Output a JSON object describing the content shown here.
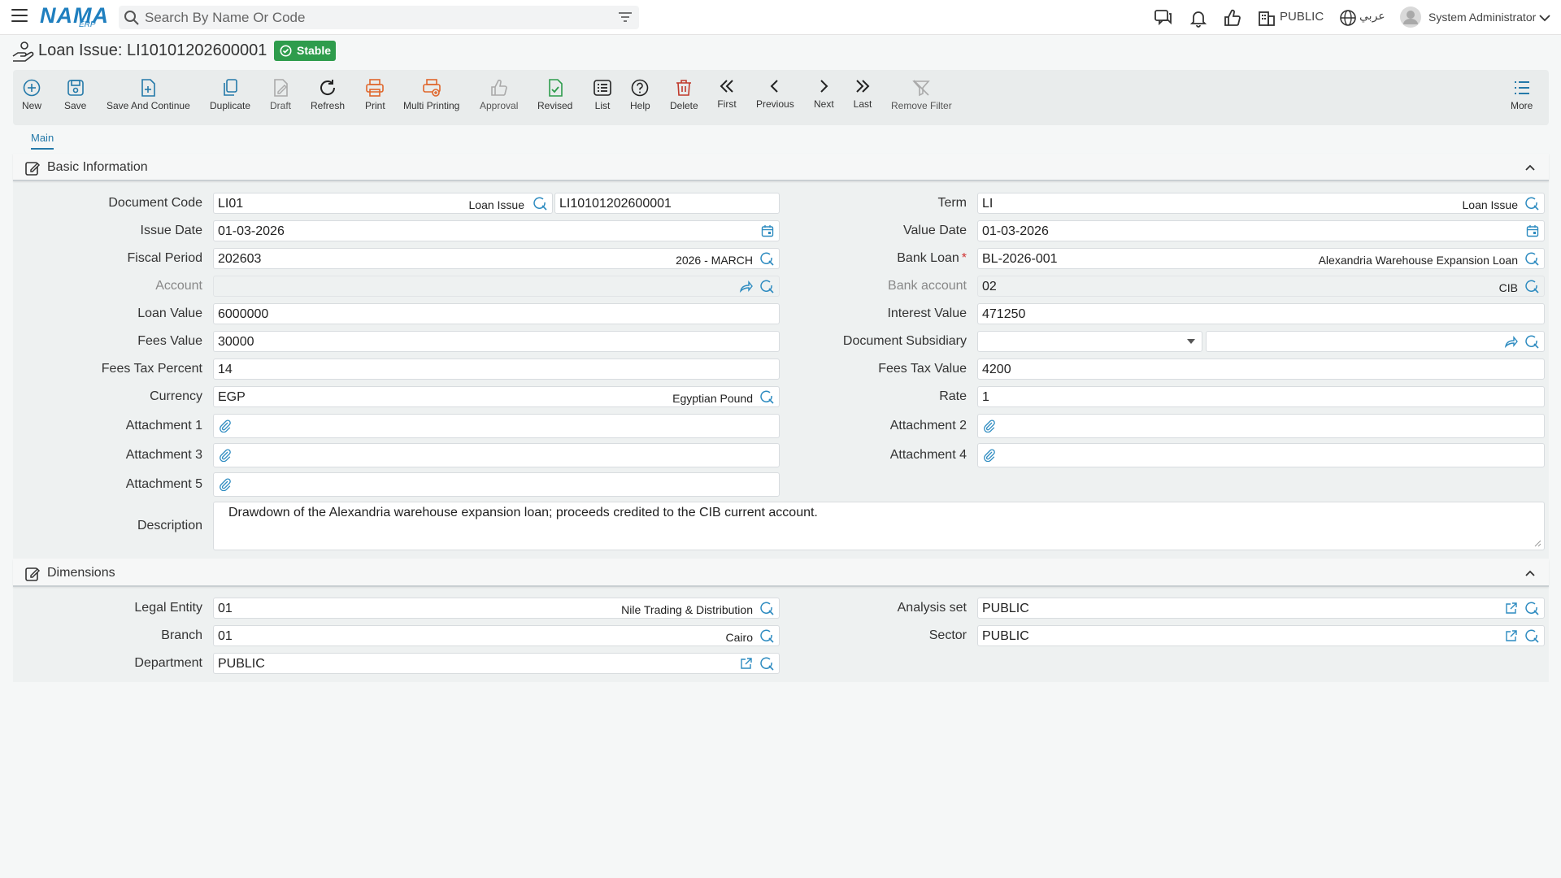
{
  "topbar": {
    "logo_name": "NAMA",
    "logo_sub": "ERP",
    "search_placeholder": "Search By Name Or Code",
    "company": "PUBLIC",
    "language": "عربي",
    "user": "System Administrator"
  },
  "title": {
    "text": "Loan Issue: LI10101202600001",
    "status": "Stable"
  },
  "toolbar": {
    "new": "New",
    "save": "Save",
    "save_continue": "Save And Continue",
    "duplicate": "Duplicate",
    "draft": "Draft",
    "refresh": "Refresh",
    "print": "Print",
    "multi_printing": "Multi Printing",
    "approval": "Approval",
    "revised": "Revised",
    "list": "List",
    "help": "Help",
    "delete": "Delete",
    "first": "First",
    "previous": "Previous",
    "next": "Next",
    "last": "Last",
    "remove_filter": "Remove Filter",
    "more": "More"
  },
  "tabs": {
    "main": "Main"
  },
  "basic": {
    "title": "Basic Information",
    "document_code": {
      "label": "Document Code",
      "value": "LI01",
      "desc": "Loan Issue",
      "code": "LI10101202600001"
    },
    "term": {
      "label": "Term",
      "value": "LI",
      "desc": "Loan Issue"
    },
    "issue_date": {
      "label": "Issue Date",
      "value": "01-03-2026"
    },
    "value_date": {
      "label": "Value Date",
      "value": "01-03-2026"
    },
    "fiscal_period": {
      "label": "Fiscal Period",
      "value": "202603",
      "desc": "2026 - MARCH"
    },
    "bank_loan": {
      "label": "Bank Loan",
      "required": "*",
      "value": "BL-2026-001",
      "desc": "Alexandria Warehouse Expansion Loan"
    },
    "account": {
      "label": "Account",
      "value": ""
    },
    "bank_account": {
      "label": "Bank account",
      "value": "02",
      "desc": "CIB"
    },
    "loan_value": {
      "label": "Loan Value",
      "value": "6000000"
    },
    "interest_value": {
      "label": "Interest Value",
      "value": "471250"
    },
    "fees_value": {
      "label": "Fees Value",
      "value": "30000"
    },
    "document_subsidiary": {
      "label": "Document Subsidiary",
      "value": ""
    },
    "fees_tax_percent": {
      "label": "Fees Tax Percent",
      "value": "14"
    },
    "fees_tax_value": {
      "label": "Fees Tax Value",
      "value": "4200"
    },
    "currency": {
      "label": "Currency",
      "value": "EGP",
      "desc": "Egyptian Pound"
    },
    "rate": {
      "label": "Rate",
      "value": "1"
    },
    "attachment1": {
      "label": "Attachment 1"
    },
    "attachment2": {
      "label": "Attachment 2"
    },
    "attachment3": {
      "label": "Attachment 3"
    },
    "attachment4": {
      "label": "Attachment 4"
    },
    "attachment5": {
      "label": "Attachment 5"
    },
    "description": {
      "label": "Description",
      "value": "Drawdown of the Alexandria warehouse expansion loan; proceeds credited to the CIB current account."
    }
  },
  "dimensions": {
    "title": "Dimensions",
    "legal_entity": {
      "label": "Legal Entity",
      "value": "01",
      "desc": "Nile Trading & Distribution"
    },
    "analysis_set": {
      "label": "Analysis set",
      "value": "PUBLIC"
    },
    "branch": {
      "label": "Branch",
      "value": "01",
      "desc": "Cairo"
    },
    "sector": {
      "label": "Sector",
      "value": "PUBLIC"
    },
    "department": {
      "label": "Department",
      "value": "PUBLIC"
    }
  }
}
